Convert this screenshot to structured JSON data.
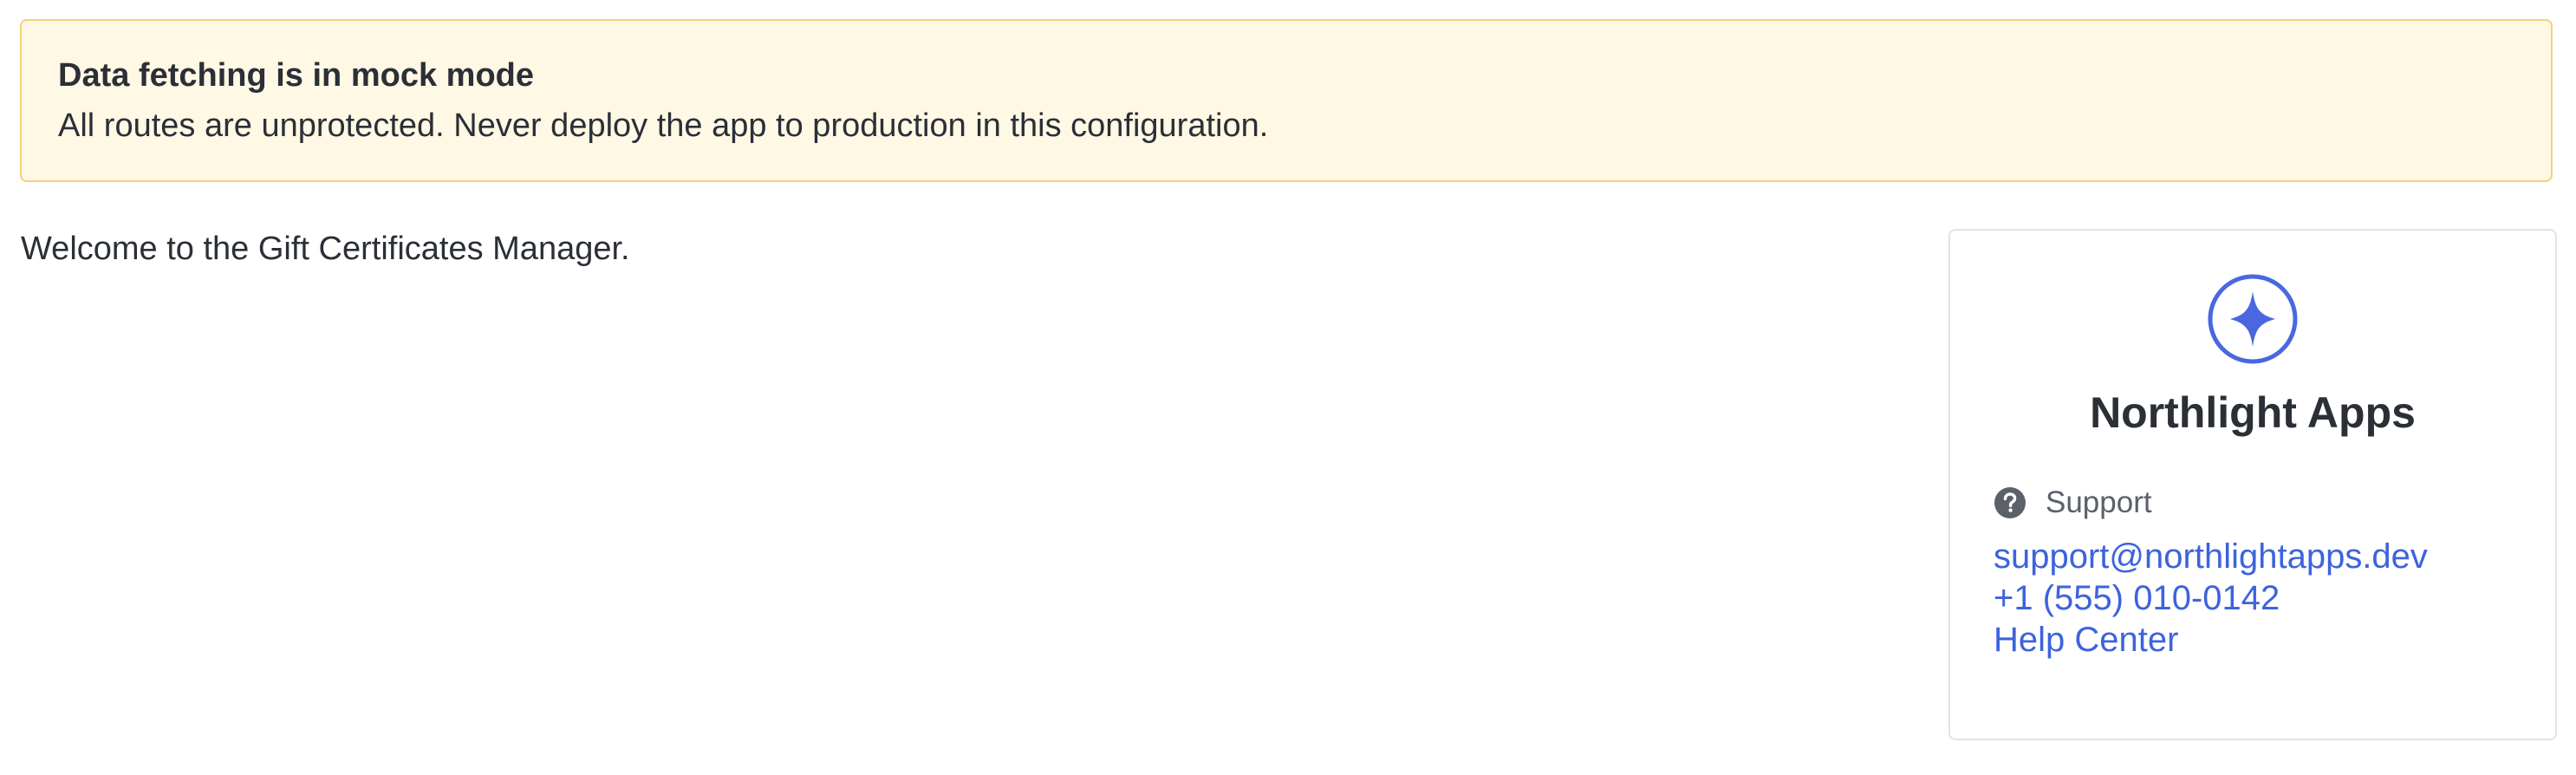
{
  "banner": {
    "title": "Data fetching is in mock mode",
    "message": "All routes are unprotected. Never deploy the app to production in this configuration."
  },
  "main": {
    "welcome_text": "Welcome to the Gift Certificates Manager."
  },
  "sidebar_card": {
    "logo_icon": "four-point-star-icon",
    "org_name": "Northlight Apps",
    "support": {
      "icon": "question-circle-icon",
      "label": "Support",
      "email": "support@northlightapps.dev",
      "phone": "+1 (555) 010-0142",
      "help_center": "Help Center"
    }
  },
  "colors": {
    "banner_background": "#fff8e5",
    "banner_border": "#f1d27a",
    "link": "#3d63dd",
    "brand_accent": "#4a67e0",
    "text_primary": "#2b2f36",
    "text_secondary": "#5b606b"
  }
}
